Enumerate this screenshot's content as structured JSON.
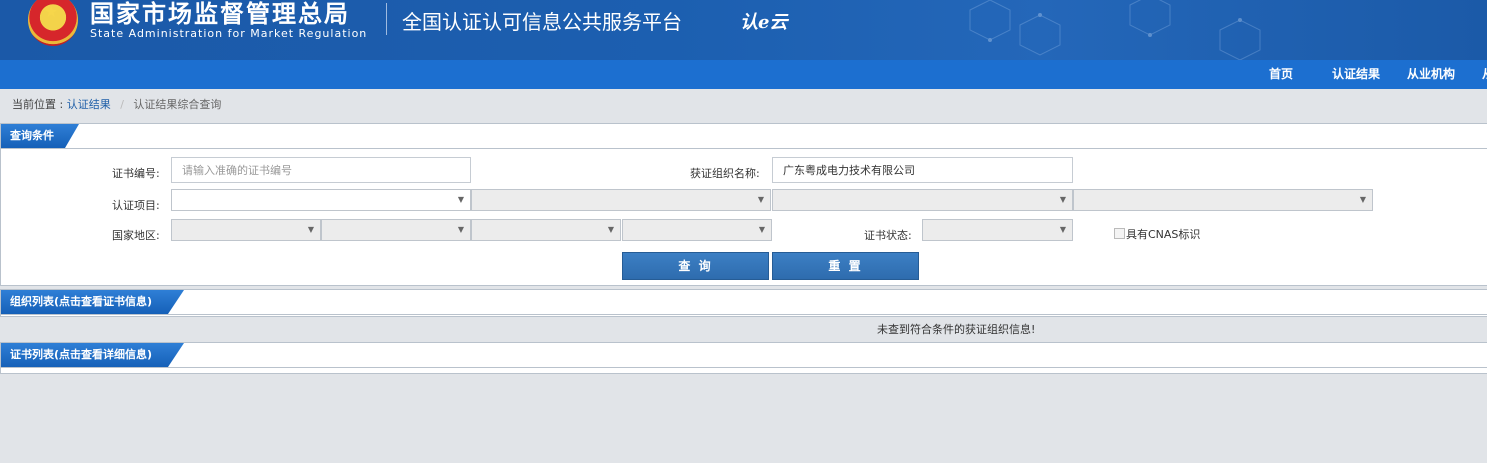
{
  "header": {
    "agency_cn": "国家市场监督管理总局",
    "agency_en": "State Administration  for  Market Regulation",
    "platform_title": "全国认证认可信息公共服务平台",
    "logo_text": "认e云"
  },
  "nav": {
    "items": [
      "首页",
      "认证结果",
      "从业机构",
      "从"
    ]
  },
  "breadcrumb": {
    "prefix": "当前位置 :",
    "link": "认证结果",
    "separator": "/",
    "current": "认证结果综合查询"
  },
  "query_panel": {
    "title": "查询条件",
    "cert_no_label": "证书编号:",
    "cert_no_placeholder": "请输入准确的证书编号",
    "org_name_label": "获证组织名称:",
    "org_name_value": "广东粤成电力技术有限公司",
    "project_label": "认证项目:",
    "region_label": "国家地区:",
    "status_label": "证书状态:",
    "cnas_label": "具有CNAS标识",
    "search_button": "查 询",
    "reset_button": "重 置"
  },
  "org_panel": {
    "title": "组织列表(点击查看证书信息)",
    "empty_message": "未查到符合条件的获证组织信息!"
  },
  "cert_panel": {
    "title": "证书列表(点击查看详细信息)"
  },
  "colors": {
    "header_bg": "#1c5fb0",
    "nav_bg": "#1c6fd0",
    "panel_tab": "#1560b8",
    "button": "#2e6cae",
    "page_bg": "#e1e4e8"
  }
}
